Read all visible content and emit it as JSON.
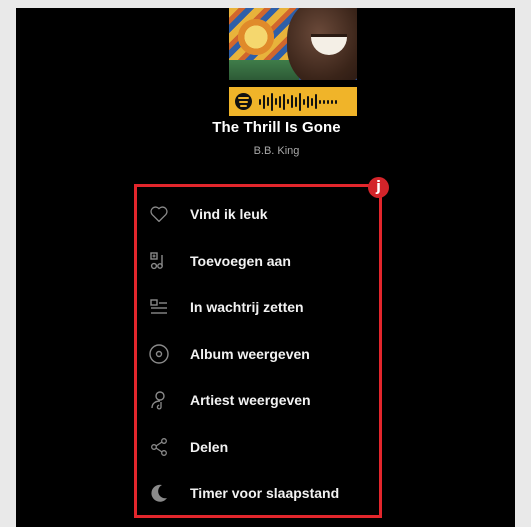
{
  "track": {
    "title": "The Thrill Is Gone",
    "artist": "B.B. King"
  },
  "menu": {
    "items": [
      {
        "label": "Vind ik leuk",
        "icon": "heart-icon"
      },
      {
        "label": "Toevoegen aan",
        "icon": "add-to-playlist-icon"
      },
      {
        "label": "In wachtrij zetten",
        "icon": "queue-icon"
      },
      {
        "label": "Album weergeven",
        "icon": "album-icon"
      },
      {
        "label": "Artiest weergeven",
        "icon": "artist-icon"
      },
      {
        "label": "Delen",
        "icon": "share-icon"
      },
      {
        "label": "Timer voor slaapstand",
        "icon": "moon-icon"
      }
    ]
  },
  "annotation": {
    "badge": "j",
    "color": "#e3262c"
  },
  "colors": {
    "background": "#000000",
    "code_bg": "#f0b429"
  }
}
